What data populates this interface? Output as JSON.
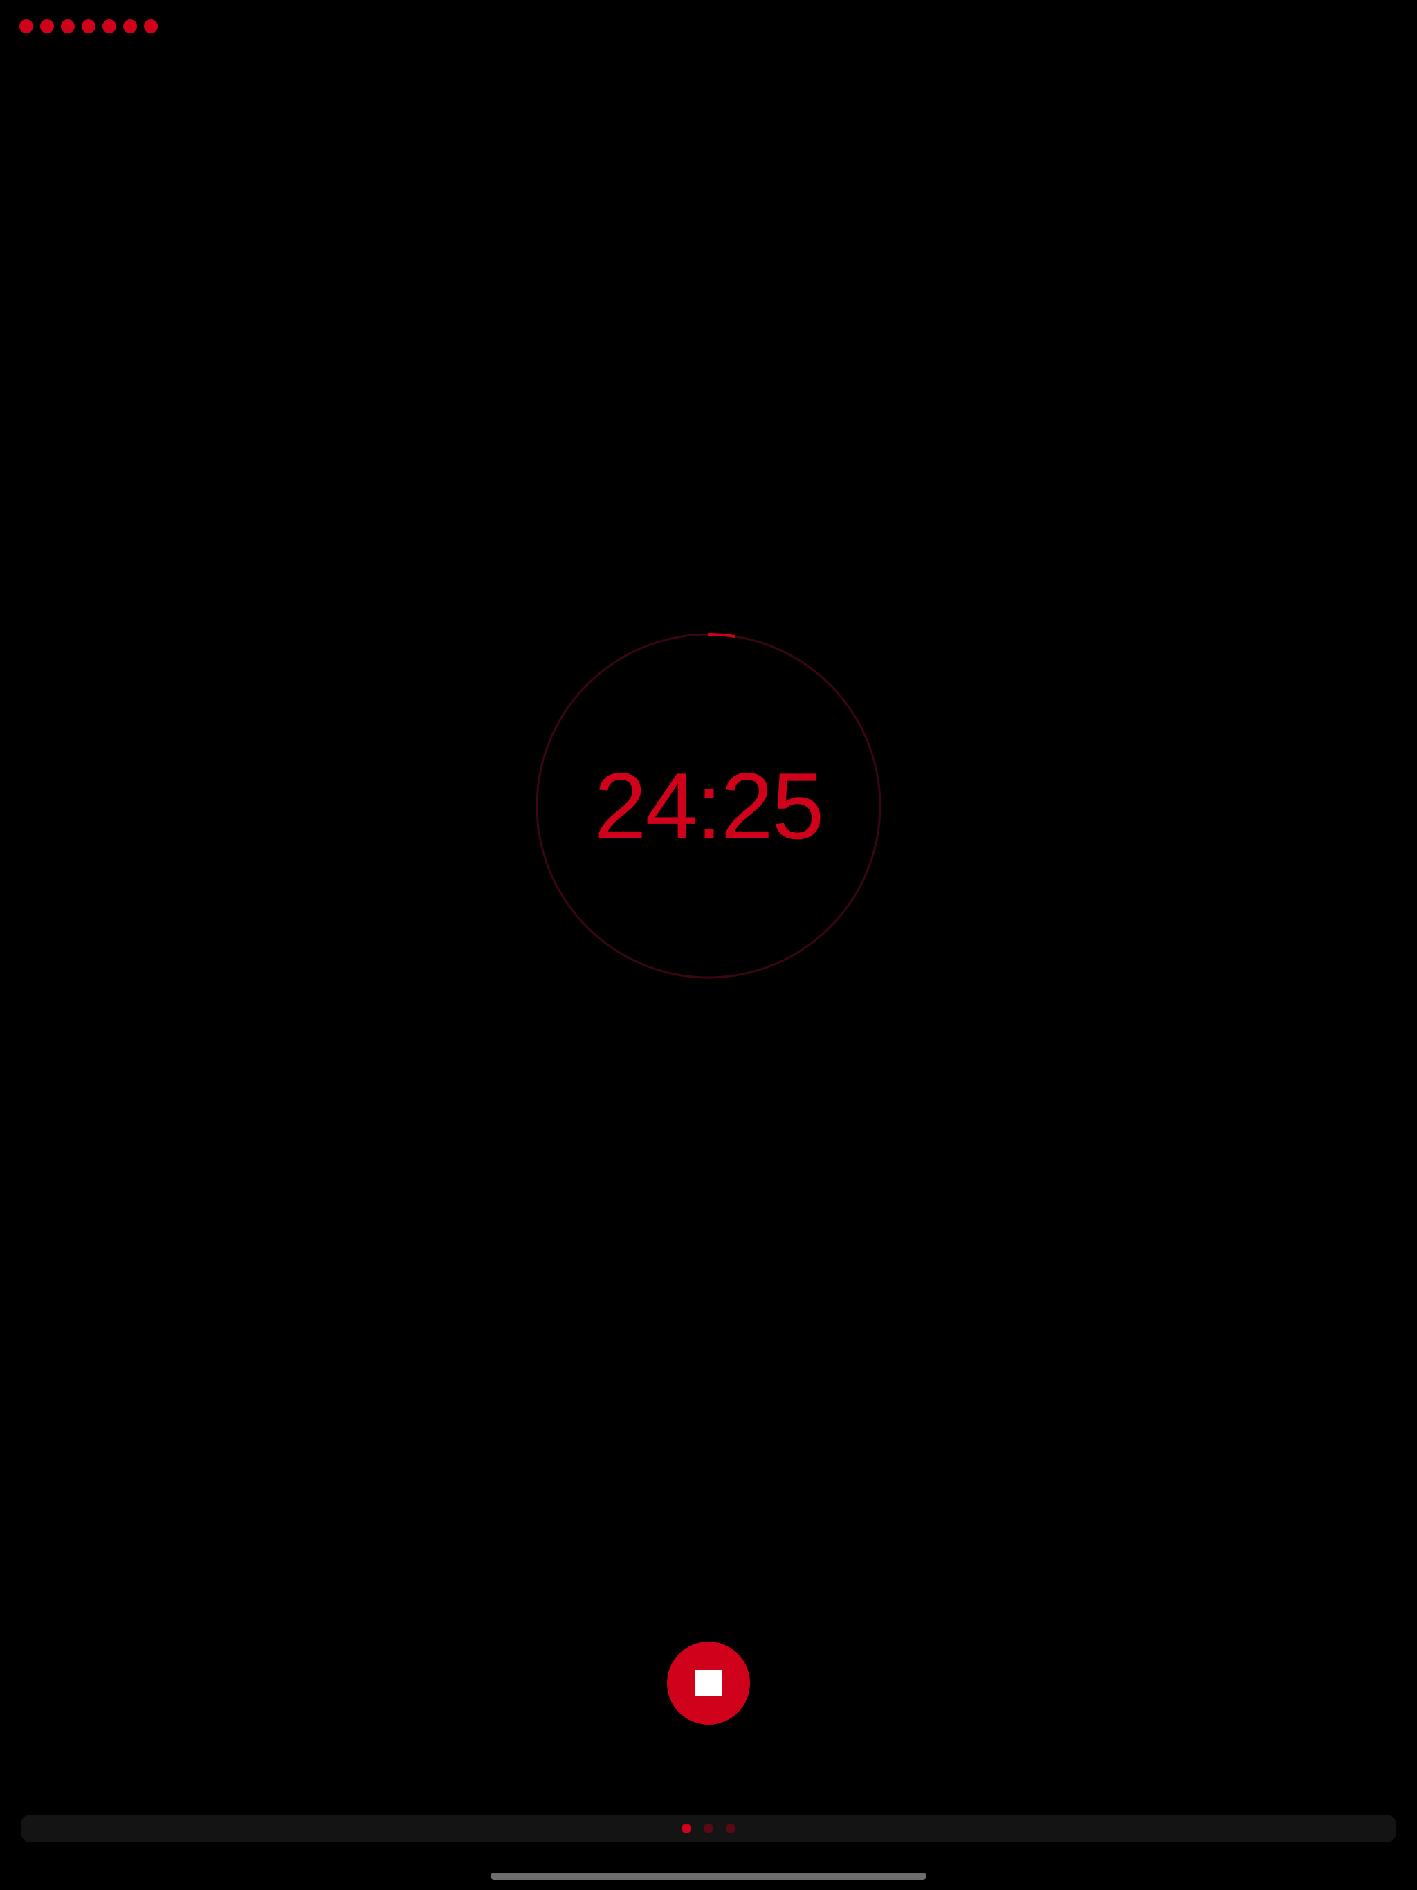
{
  "colors": {
    "background": "#000000",
    "accent": "#d0021b",
    "ring_track": "#3a0610",
    "page_dot_inactive": "#5a0a14",
    "bar": "#141414",
    "home_indicator": "#6e6e6e"
  },
  "sessions": {
    "completed_count": 7
  },
  "timer": {
    "display": "24:25",
    "progress_fraction": 0.025
  },
  "controls": {
    "stop_icon": "stop-icon"
  },
  "pager": {
    "page_count": 3,
    "active_index": 0
  }
}
